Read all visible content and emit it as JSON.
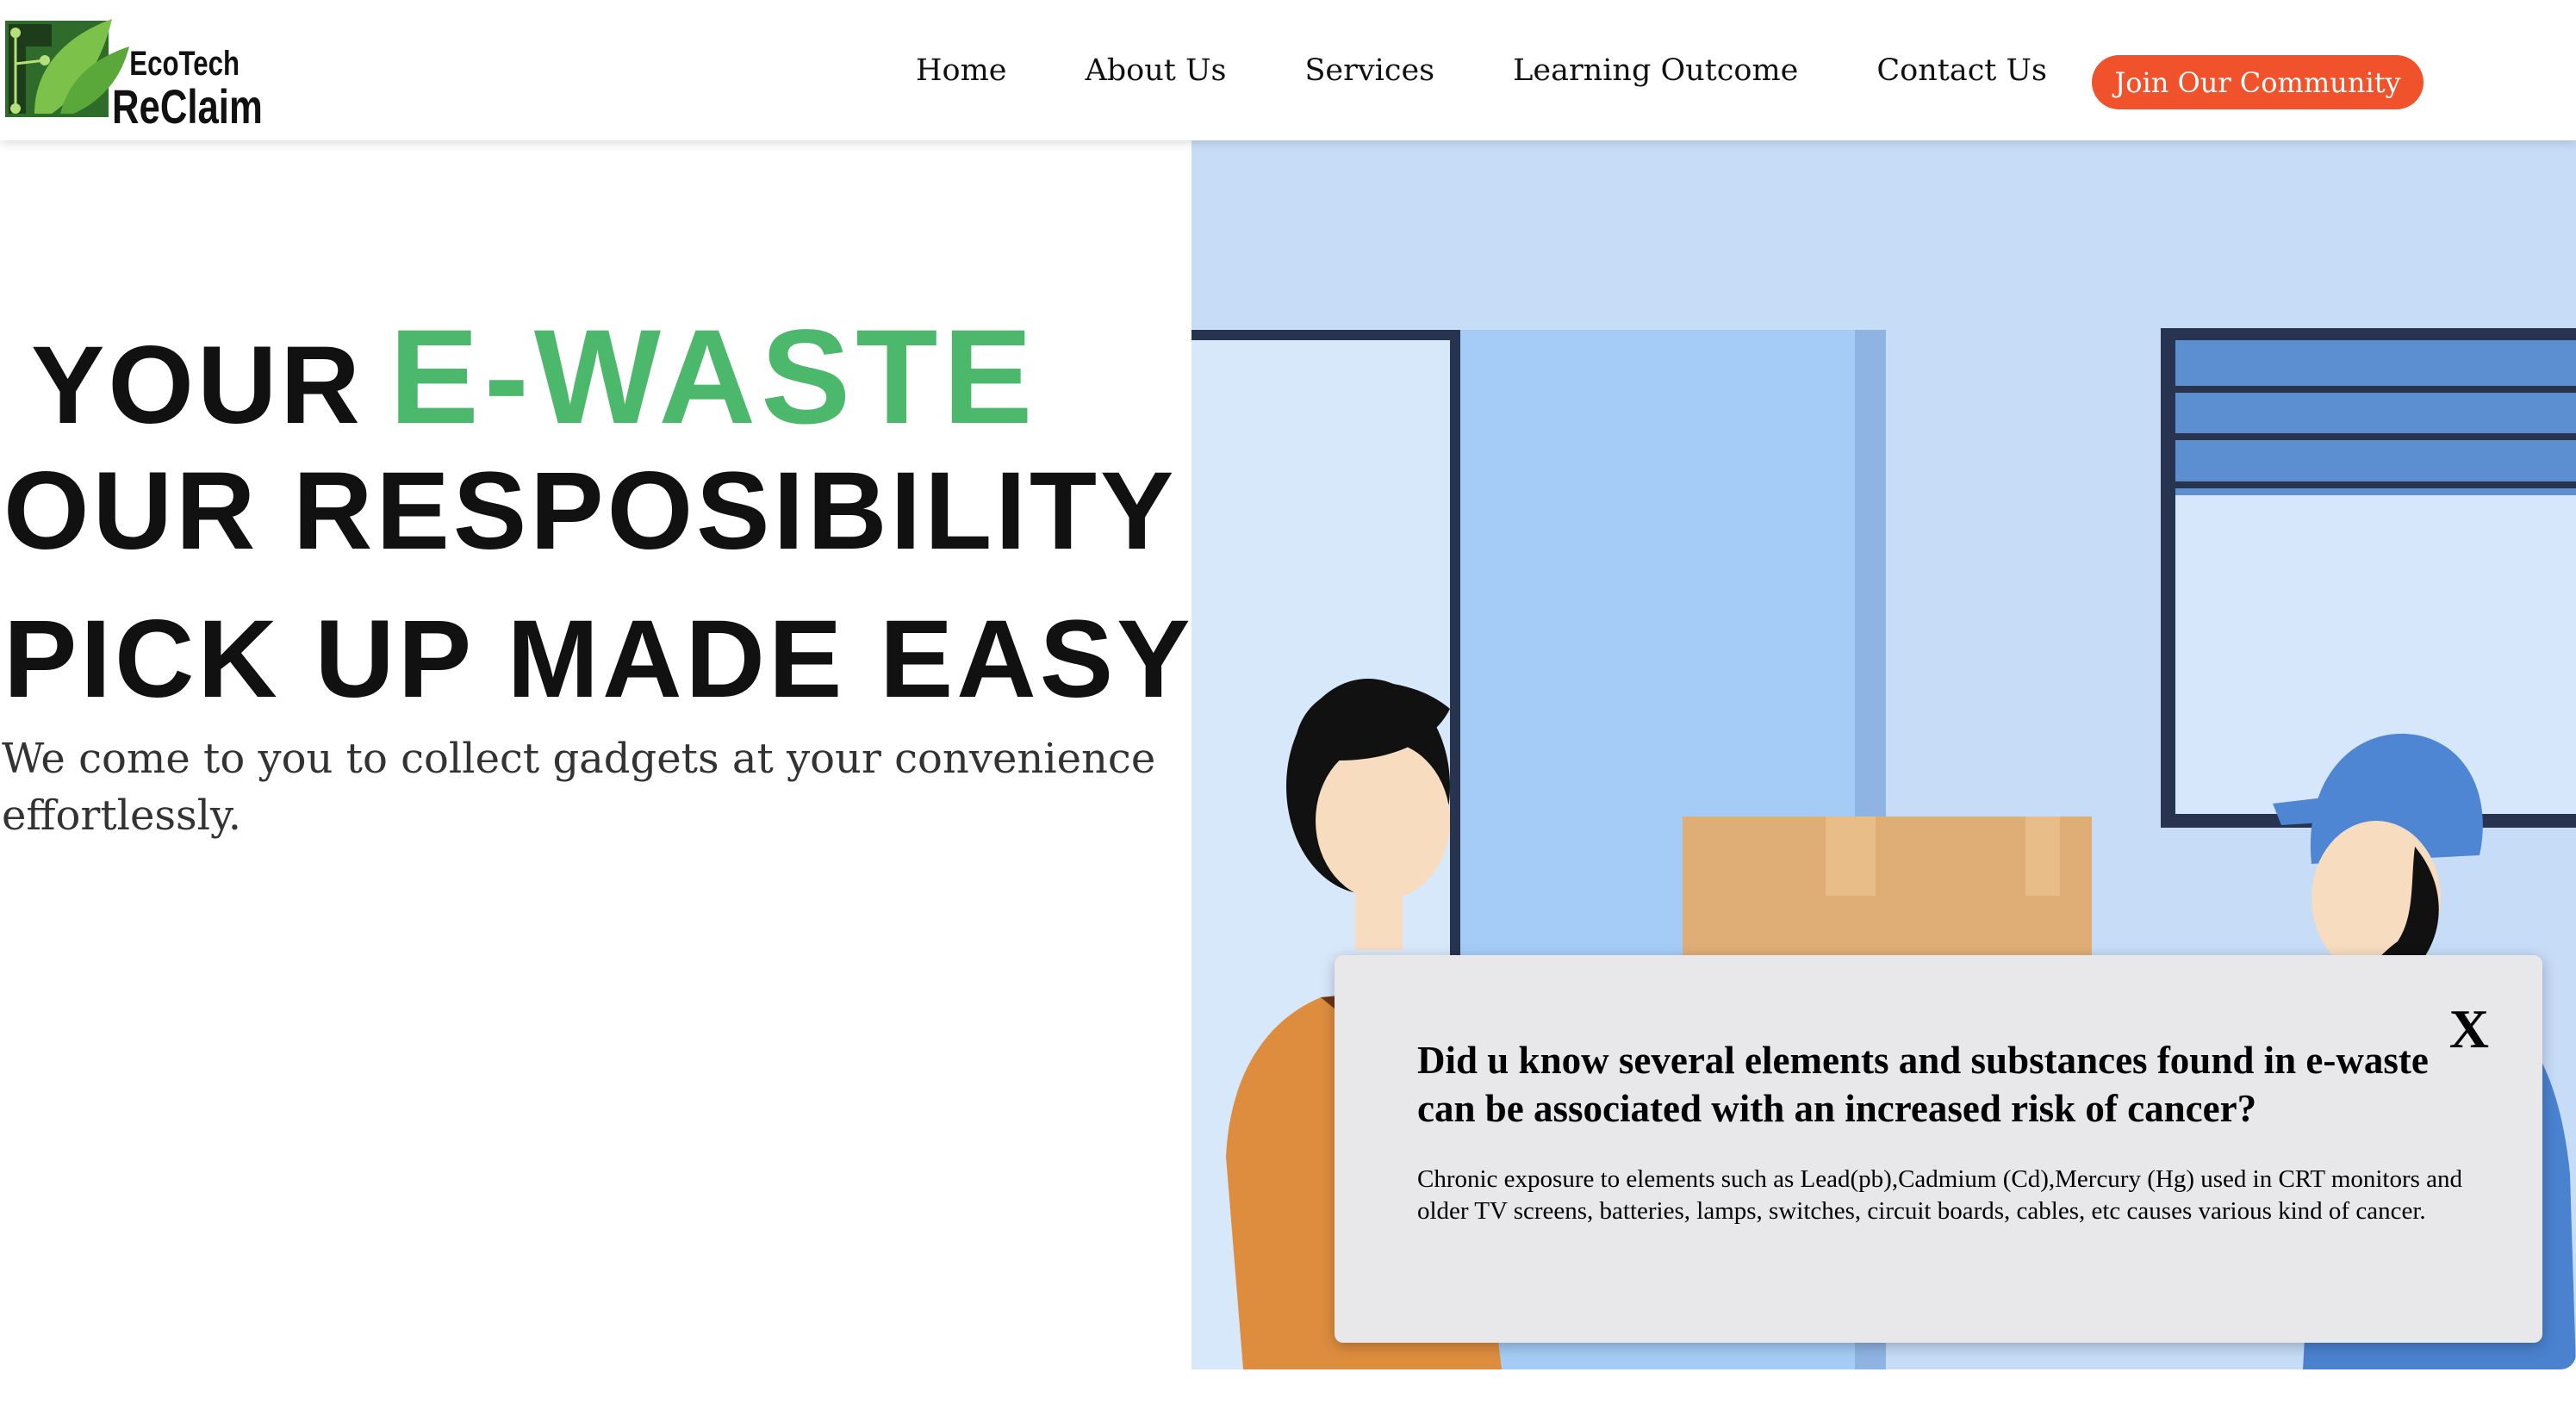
{
  "brand": {
    "line1": "EcoTech",
    "line2": "ReClaim"
  },
  "nav": {
    "items": [
      {
        "label": "Home"
      },
      {
        "label": "About Us"
      },
      {
        "label": "Services"
      },
      {
        "label": "Learning Outcome"
      },
      {
        "label": "Contact Us"
      }
    ],
    "cta_label": "Join Our Community"
  },
  "hero": {
    "line1_prefix": "YOUR",
    "line1_highlight": "E-WASTE",
    "line2": "OUR RESPOSIBILITY",
    "line3": "PICK UP MADE EASY!",
    "subtitle": "We come to you to collect gadgets at your convenience effortlessly."
  },
  "popup": {
    "close_label": "X",
    "title": "Did u know several elements and substances found in e-waste can be associated with an increased risk of cancer?",
    "body": "Chronic exposure to elements such as Lead(pb),Cadmium (Cd),Mercury (Hg) used in CRT monitors and older TV screens, batteries, lamps, switches, circuit boards, cables, etc causes various kind of cancer."
  },
  "colors": {
    "accent_green": "#4bb86b",
    "cta_orange": "#f0522b",
    "illustration_bg": "#c6dcf7"
  },
  "icons": {
    "logo": "circuit-leaf-logo-icon"
  }
}
